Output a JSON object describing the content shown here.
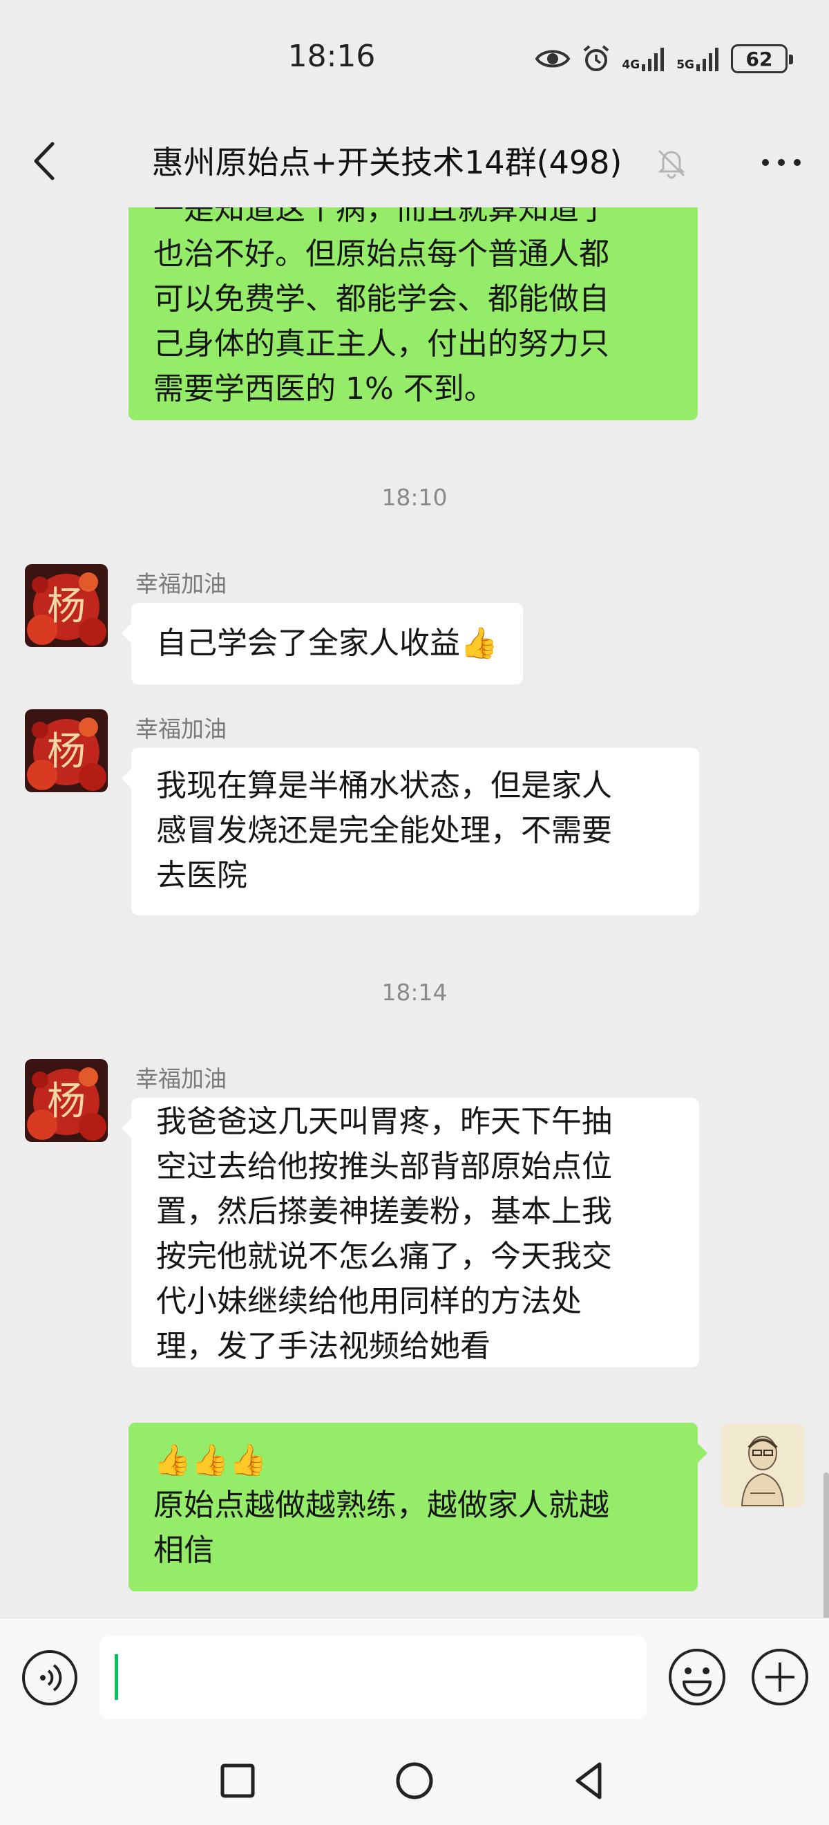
{
  "status_bar": {
    "time": "18:16",
    "network_1": "4G",
    "network_2": "5G",
    "battery": "62"
  },
  "header": {
    "title": "惠州原始点+开关技术14群(498)"
  },
  "messages": [
    {
      "side": "right",
      "lines": [
        "一是知道这个病，而且就算知道了",
        "也治不好。但原始点每个普通人都",
        "可以免费学、都能学会、都能做自",
        "己身体的真正主人，付出的努力只",
        "需要学西医的 1% 不到。"
      ]
    },
    {
      "timestamp": "18:10"
    },
    {
      "side": "left",
      "sender": "幸福加油",
      "lines": [
        "自己学会了全家人收益"
      ],
      "trailing_emoji": "👍"
    },
    {
      "side": "left",
      "sender": "幸福加油",
      "lines": [
        "我现在算是半桶水状态，但是家人",
        "感冒发烧还是完全能处理，不需要",
        "去医院"
      ]
    },
    {
      "timestamp": "18:14"
    },
    {
      "side": "left",
      "sender": "幸福加油",
      "lines": [
        "我爸爸这几天叫胃疼，昨天下午抽",
        "空过去给他按推头部背部原始点位",
        "置，然后搽姜神搓姜粉，基本上我",
        "按完他就说不怎么痛了，今天我交",
        "代小妹继续给他用同样的方法处",
        "理，发了手法视频给她看"
      ]
    },
    {
      "side": "right",
      "leading_emoji": "👍👍👍",
      "lines": [
        "原始点越做越熟练，越做家人就越",
        "相信"
      ]
    }
  ],
  "avatar_text": "杨",
  "input": {
    "value": ""
  },
  "icons": {
    "back": "chevron-left-icon",
    "mute": "bell-off-icon",
    "more": "more-horizontal-icon",
    "voice": "voice-icon",
    "emoji": "emoji-icon",
    "plus": "plus-circle-icon"
  },
  "colors": {
    "self_bubble": "#95ec69",
    "other_bubble": "#ffffff",
    "background": "#ededed",
    "caret": "#07c160"
  }
}
